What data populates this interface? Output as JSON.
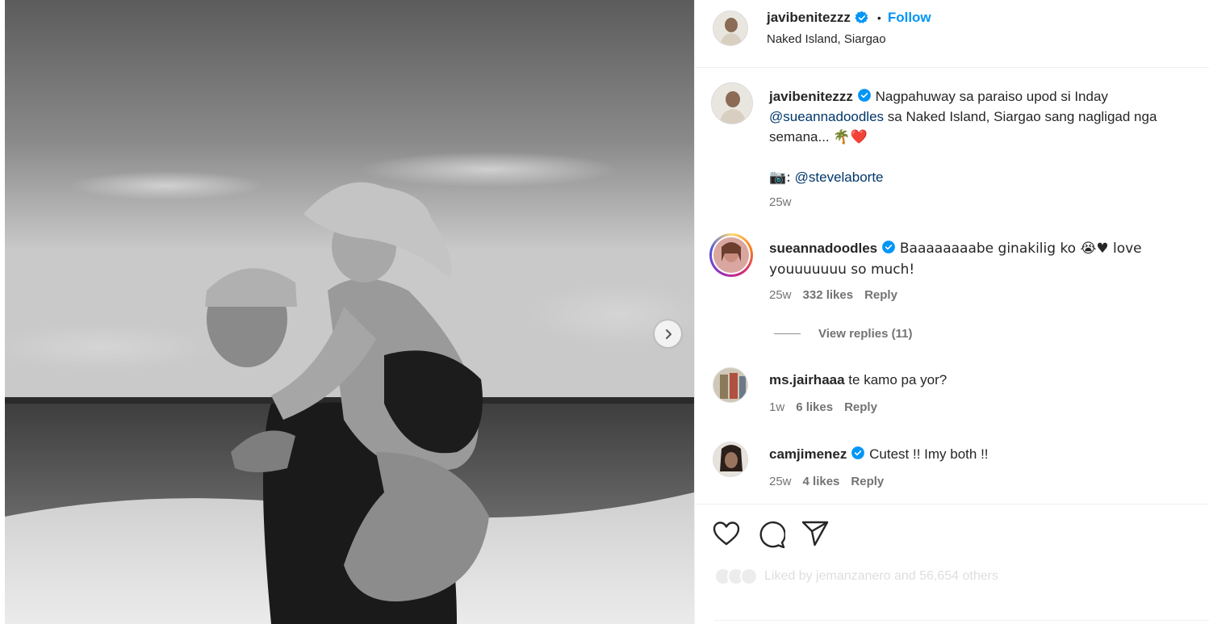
{
  "post": {
    "photo_alt": "Black and white beach photo of a smiling man giving a piggyback ride to a woman in a bucket hat"
  },
  "header": {
    "username": "javibenitezzz",
    "separator": "•",
    "follow_label": "Follow",
    "location": "Naked Island, Siargao"
  },
  "caption": {
    "username": "javibenitezzz",
    "text_before": "Nagpahuway sa paraiso upod si Inday",
    "mention": "@sueannadoodles",
    "text_after": "sa Naked Island, Siargao sang nagligad nga semana...",
    "emojis": "🌴❤️",
    "photo_credit_prefix": "📷:",
    "photo_credit_mention": "@stevelaborte",
    "time": "25w"
  },
  "comments": [
    {
      "username": "sueannadoodles",
      "verified": true,
      "text": "Baaaaaaaabe ginakilig ko 😭♥ love youuuuuuu so much!",
      "time": "25w",
      "likes": "332 likes",
      "reply_label": "Reply",
      "view_replies": "View replies (11)"
    },
    {
      "username": "ms.jairhaaa",
      "verified": false,
      "text": "te kamo pa yor?",
      "time": "1w",
      "likes": "6 likes",
      "reply_label": "Reply"
    },
    {
      "username": "camjimenez",
      "verified": true,
      "text": "Cutest !! Imy both !!",
      "time": "25w",
      "likes": "4 likes",
      "reply_label": "Reply"
    }
  ],
  "actions": {
    "like_icon": "heart-icon",
    "comment_icon": "comment-icon",
    "share_icon": "share-icon",
    "liked_by_text": "Liked by jemanzanero and 56,654 others"
  },
  "colors": {
    "follow_blue": "#0095f6",
    "verified_blue": "#0095f6",
    "mention_blue": "#00376b",
    "muted_gray": "#737373"
  }
}
